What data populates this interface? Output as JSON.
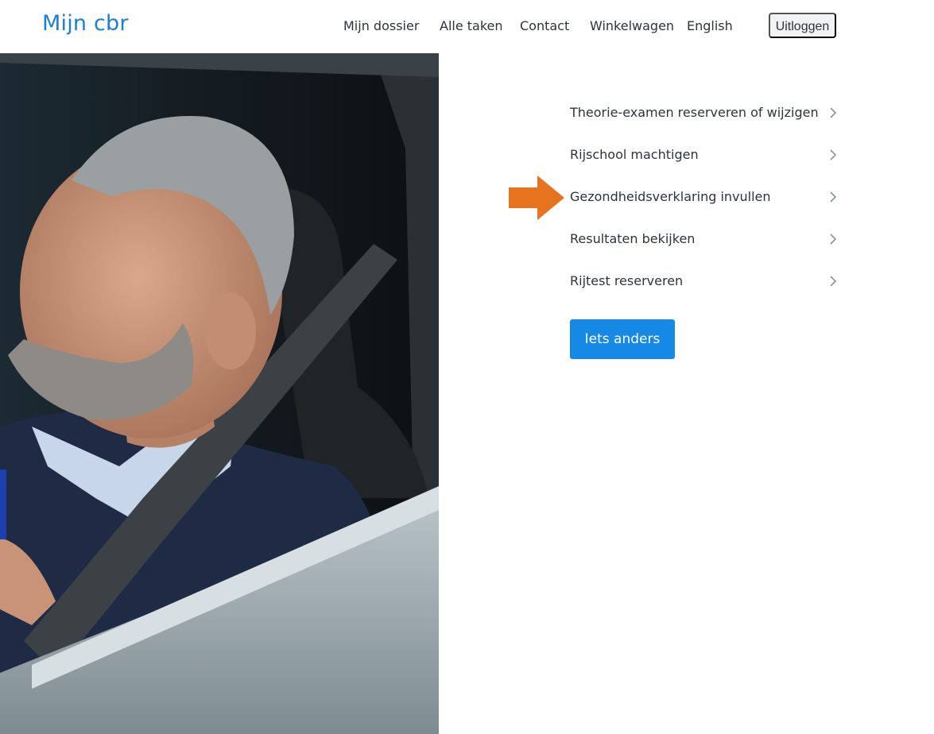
{
  "header": {
    "logo": "Mijn cbr",
    "nav": [
      "Mijn dossier",
      "Alle taken",
      "Contact",
      "Winkelwagen",
      "English"
    ],
    "logout": "Uitloggen"
  },
  "tasks": [
    "Theorie-examen reserveren of wijzigen",
    "Rijschool machtigen",
    "Gezondheidsverklaring invullen",
    "Resultaten bekijken",
    "Rijtest reserveren"
  ],
  "other_button": "Iets anders",
  "colors": {
    "brand": "#1a7fd6",
    "button": "#1689e6",
    "arrow": "#e8731f"
  }
}
